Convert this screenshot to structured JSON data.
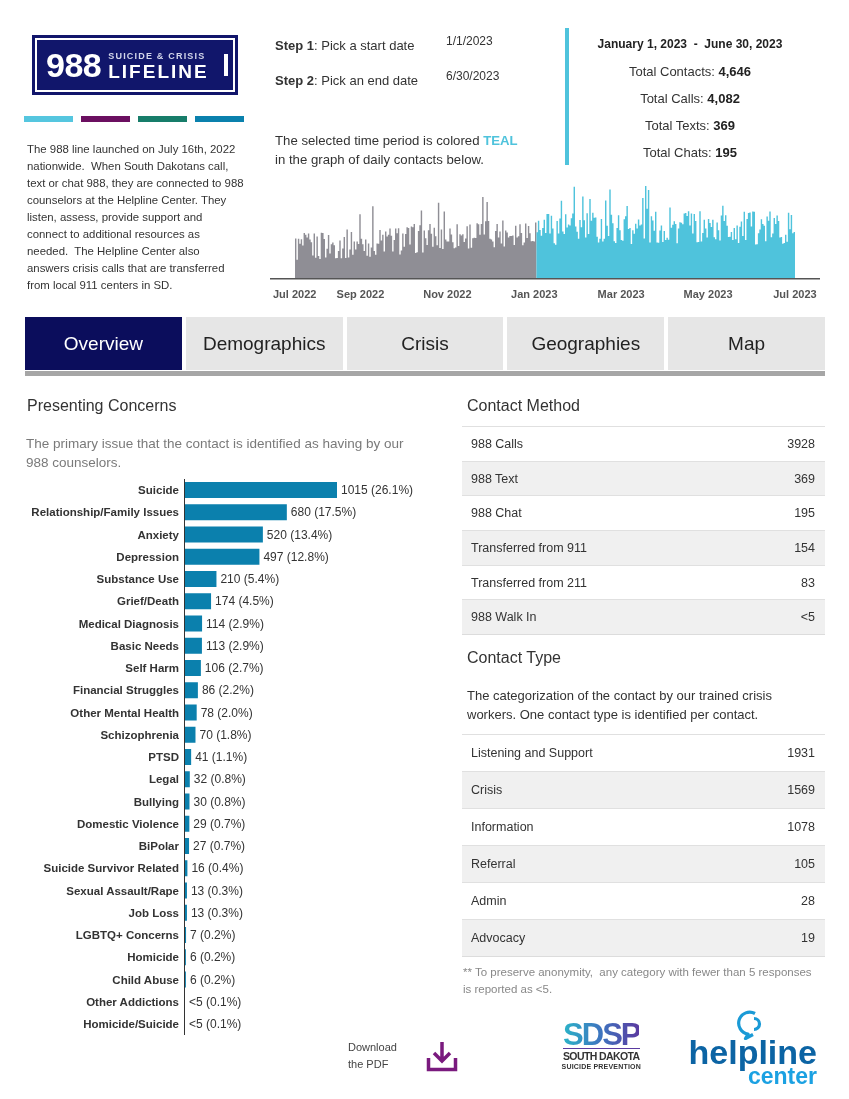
{
  "logo": {
    "number": "988",
    "tagline": "SUICIDE & CRISIS",
    "name": "LIFELINE"
  },
  "intro": "The 988 line launched on July 16th, 2022 nationwide.  When South Dakotans call, text or chat 988, they are connected to 988 counselors at the Helpline Center. They listen, assess, provide support and connect to additional resources as needed.  The Helpline Center also answers crisis calls that are transferred from local 911 centers in SD.",
  "date_steps": [
    {
      "label": "**Step 1**: Pick a start date",
      "value": "1/1/2023"
    },
    {
      "label": "**Step 2**: Pick an end date",
      "value": "6/30/2023"
    }
  ],
  "selection_note": "The selected time period is colored **TEAL** in the graph of daily contacts below.",
  "summary": {
    "period": "January 1, 2023  -  June 30, 2023",
    "totals": [
      "Total Contacts: **4,646**",
      "Total Calls: **4,082**",
      "Total Texts: **369**",
      "Total Chats: **195**"
    ]
  },
  "daily_contacts": {
    "axis_labels": [
      "Jul 2022",
      "Sep 2022",
      "Nov 2022",
      "Jan 2023",
      "Mar 2023",
      "May 2023",
      "Jul 2023"
    ]
  },
  "tabs": [
    {
      "label": "Overview",
      "selected": true
    },
    {
      "label": "Demographics",
      "selected": false
    },
    {
      "label": "Crisis",
      "selected": false
    },
    {
      "label": "Geographies",
      "selected": false
    },
    {
      "label": "Map",
      "selected": false
    }
  ],
  "presenting_concerns": {
    "title": "Presenting Concerns",
    "description": "The primary issue that the contact is identified as having by our 988 counselors.",
    "chart_data": {
      "type": "bar",
      "orientation": "horizontal",
      "categories": [
        "Suicide",
        "Relationship/Family Issues",
        "Anxiety",
        "Depression",
        "Substance Use",
        "Grief/Death",
        "Medical Diagnosis",
        "Basic Needs",
        "Self Harm",
        "Financial Struggles",
        "Other Mental Health",
        "Schizophrenia",
        "PTSD",
        "Legal",
        "Bullying",
        "Domestic Violence",
        "BiPolar",
        "Suicide Survivor Related",
        "Sexual Assault/Rape",
        "Job Loss",
        "LGBTQ+ Concerns",
        "Homicide",
        "Child Abuse",
        "Other Addictions",
        "Homicide/Suicide"
      ],
      "values": [
        1015,
        680,
        520,
        497,
        210,
        174,
        114,
        113,
        106,
        86,
        78,
        70,
        41,
        32,
        30,
        29,
        27,
        16,
        13,
        13,
        7,
        6,
        6,
        null,
        null
      ],
      "value_labels": [
        "1015 (26.1%)",
        "680 (17.5%)",
        "520 (13.4%)",
        "497 (12.8%)",
        "210 (5.4%)",
        "174 (4.5%)",
        "114 (2.9%)",
        "113 (2.9%)",
        "106 (2.7%)",
        "86 (2.2%)",
        "78 (2.0%)",
        "70 (1.8%)",
        "41 (1.1%)",
        "32 (0.8%)",
        "30 (0.8%)",
        "29 (0.7%)",
        "27 (0.7%)",
        "16 (0.4%)",
        "13 (0.3%)",
        "13 (0.3%)",
        "7 (0.2%)",
        "6 (0.2%)",
        "6 (0.2%)",
        "<5 (0.1%)",
        "<5 (0.1%)"
      ]
    }
  },
  "contact_method": {
    "title": "Contact Method",
    "rows": [
      {
        "label": "988 Calls",
        "value": "3928"
      },
      {
        "label": "988 Text",
        "value": "369"
      },
      {
        "label": "988 Chat",
        "value": "195"
      },
      {
        "label": "Transferred from 911",
        "value": "154"
      },
      {
        "label": "Transferred from 211",
        "value": "83"
      },
      {
        "label": "988 Walk In",
        "value": "<5"
      }
    ]
  },
  "contact_type": {
    "title": "Contact Type",
    "description": "The categorization of the contact by our trained crisis workers. One contact type is identified per contact.",
    "rows": [
      {
        "label": "Listening and Support",
        "value": "1931"
      },
      {
        "label": "Crisis",
        "value": "1569"
      },
      {
        "label": "Information",
        "value": "1078"
      },
      {
        "label": "Referral",
        "value": "105"
      },
      {
        "label": "Admin",
        "value": "28"
      },
      {
        "label": "Advocacy",
        "value": "19"
      }
    ]
  },
  "footnote": "** To preserve anonymity,  any category with fewer than 5 responses is reported as <5.",
  "download": {
    "label": "Download the PDF"
  },
  "partner_logos": [
    {
      "kind": "sdsp",
      "acronym": "SDSP",
      "name": "SOUTH DAKOTA",
      "tagline": "SUICIDE PREVENTION"
    },
    {
      "kind": "helpline",
      "name": "helpline",
      "subname": "center"
    }
  ]
}
